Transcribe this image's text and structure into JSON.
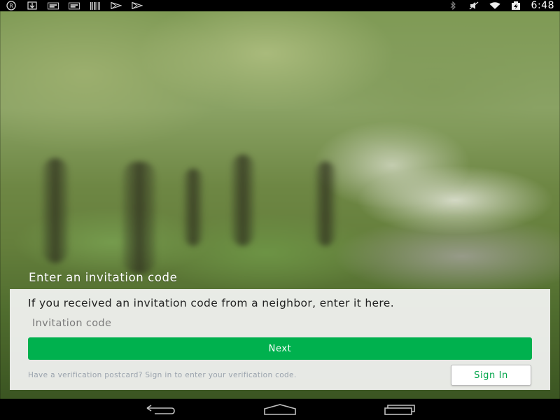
{
  "status_bar": {
    "time": "6:48",
    "left_icons": [
      "registered-icon",
      "download-icon",
      "notification-card-icon",
      "notification-card-icon",
      "barcode-icon",
      "play-store-icon",
      "play-store-icon"
    ],
    "right_icons": [
      "bluetooth-icon",
      "mute-icon",
      "wifi-icon",
      "battery-charging-icon"
    ]
  },
  "screen": {
    "heading": "Enter an invitation code"
  },
  "card": {
    "description": "If you received an invitation code from a neighbor, enter it here.",
    "input_placeholder": "Invitation code",
    "input_value": "",
    "next_label": "Next",
    "postcard_text": "Have a verification postcard? Sign in to enter your verification code.",
    "signin_label": "Sign In"
  },
  "colors": {
    "accent": "#00b14e",
    "signin_text": "#00a449",
    "card_bg": "#f5f5f5"
  },
  "nav_bar": {
    "icons": [
      "back-icon",
      "home-icon",
      "recents-icon"
    ]
  }
}
